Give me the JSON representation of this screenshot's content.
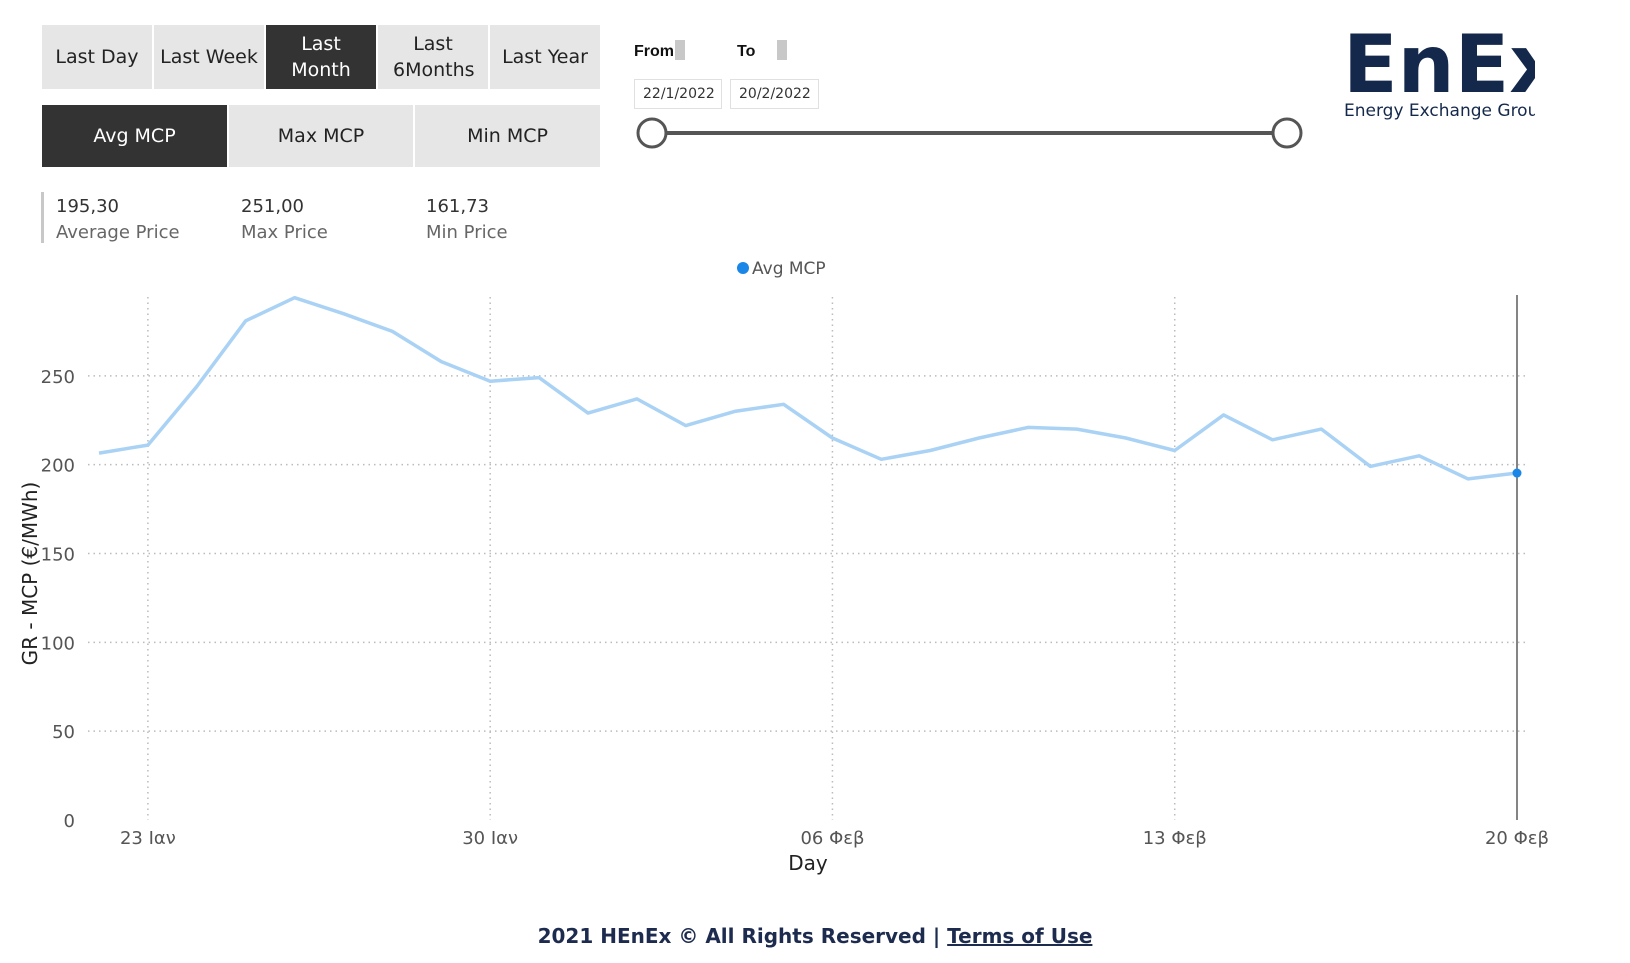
{
  "period_buttons": [
    "Last Day",
    "Last Week",
    "Last Month",
    "Last 6Months",
    "Last Year"
  ],
  "period_active": "Last Month",
  "metric_buttons": [
    "Avg MCP",
    "Max MCP",
    "Min MCP"
  ],
  "metric_active": "Avg MCP",
  "date_filter": {
    "from_label": "From",
    "to_label": "To",
    "from_value": "22/1/2022",
    "to_value": "20/2/2022"
  },
  "logo": {
    "name": "EnEx",
    "tagline": "Energy Exchange Group",
    "color": "#14284b"
  },
  "kpis": [
    {
      "value": "195,30",
      "label": "Average Price"
    },
    {
      "value": "251,00",
      "label": "Max Price"
    },
    {
      "value": "161,73",
      "label": "Min Price"
    }
  ],
  "footer": {
    "text": "2021 HEnEx © All Rights Reserved | ",
    "link": "Terms of Use"
  },
  "colors": {
    "line": "#a9d2f5",
    "point": "#1a86e8",
    "active_button": "#333333",
    "button": "#e6e6e6"
  },
  "chart_data": {
    "type": "line",
    "legend": "Avg MCP",
    "legend_position": "top-center",
    "xlabel": "Day",
    "ylabel": "GR - MCP (€/MWh)",
    "ylim": [
      0,
      300
    ],
    "yticks": [
      0,
      50,
      100,
      150,
      200,
      250
    ],
    "xticks": [
      "23 Ιαν",
      "30 Ιαν",
      "06 Φεβ",
      "13 Φεβ",
      "20 Φεβ"
    ],
    "grid": true,
    "x": [
      "22/1/2022",
      "23/1/2022",
      "24/1/2022",
      "25/1/2022",
      "26/1/2022",
      "27/1/2022",
      "28/1/2022",
      "29/1/2022",
      "30/1/2022",
      "31/1/2022",
      "1/2/2022",
      "2/2/2022",
      "3/2/2022",
      "4/2/2022",
      "5/2/2022",
      "6/2/2022",
      "7/2/2022",
      "8/2/2022",
      "9/2/2022",
      "10/2/2022",
      "11/2/2022",
      "12/2/2022",
      "13/2/2022",
      "14/2/2022",
      "15/2/2022",
      "16/2/2022",
      "17/2/2022",
      "18/2/2022",
      "19/2/2022",
      "20/2/2022"
    ],
    "series": [
      {
        "name": "Avg MCP",
        "values": [
          206.5,
          211,
          244,
          281,
          294,
          285,
          275,
          258,
          247,
          249,
          229,
          237,
          222,
          230,
          234,
          215,
          203,
          208,
          215,
          221,
          220,
          215,
          208,
          228,
          214,
          220,
          199,
          205,
          192,
          195.3
        ]
      }
    ],
    "highlight_last_point": true
  }
}
